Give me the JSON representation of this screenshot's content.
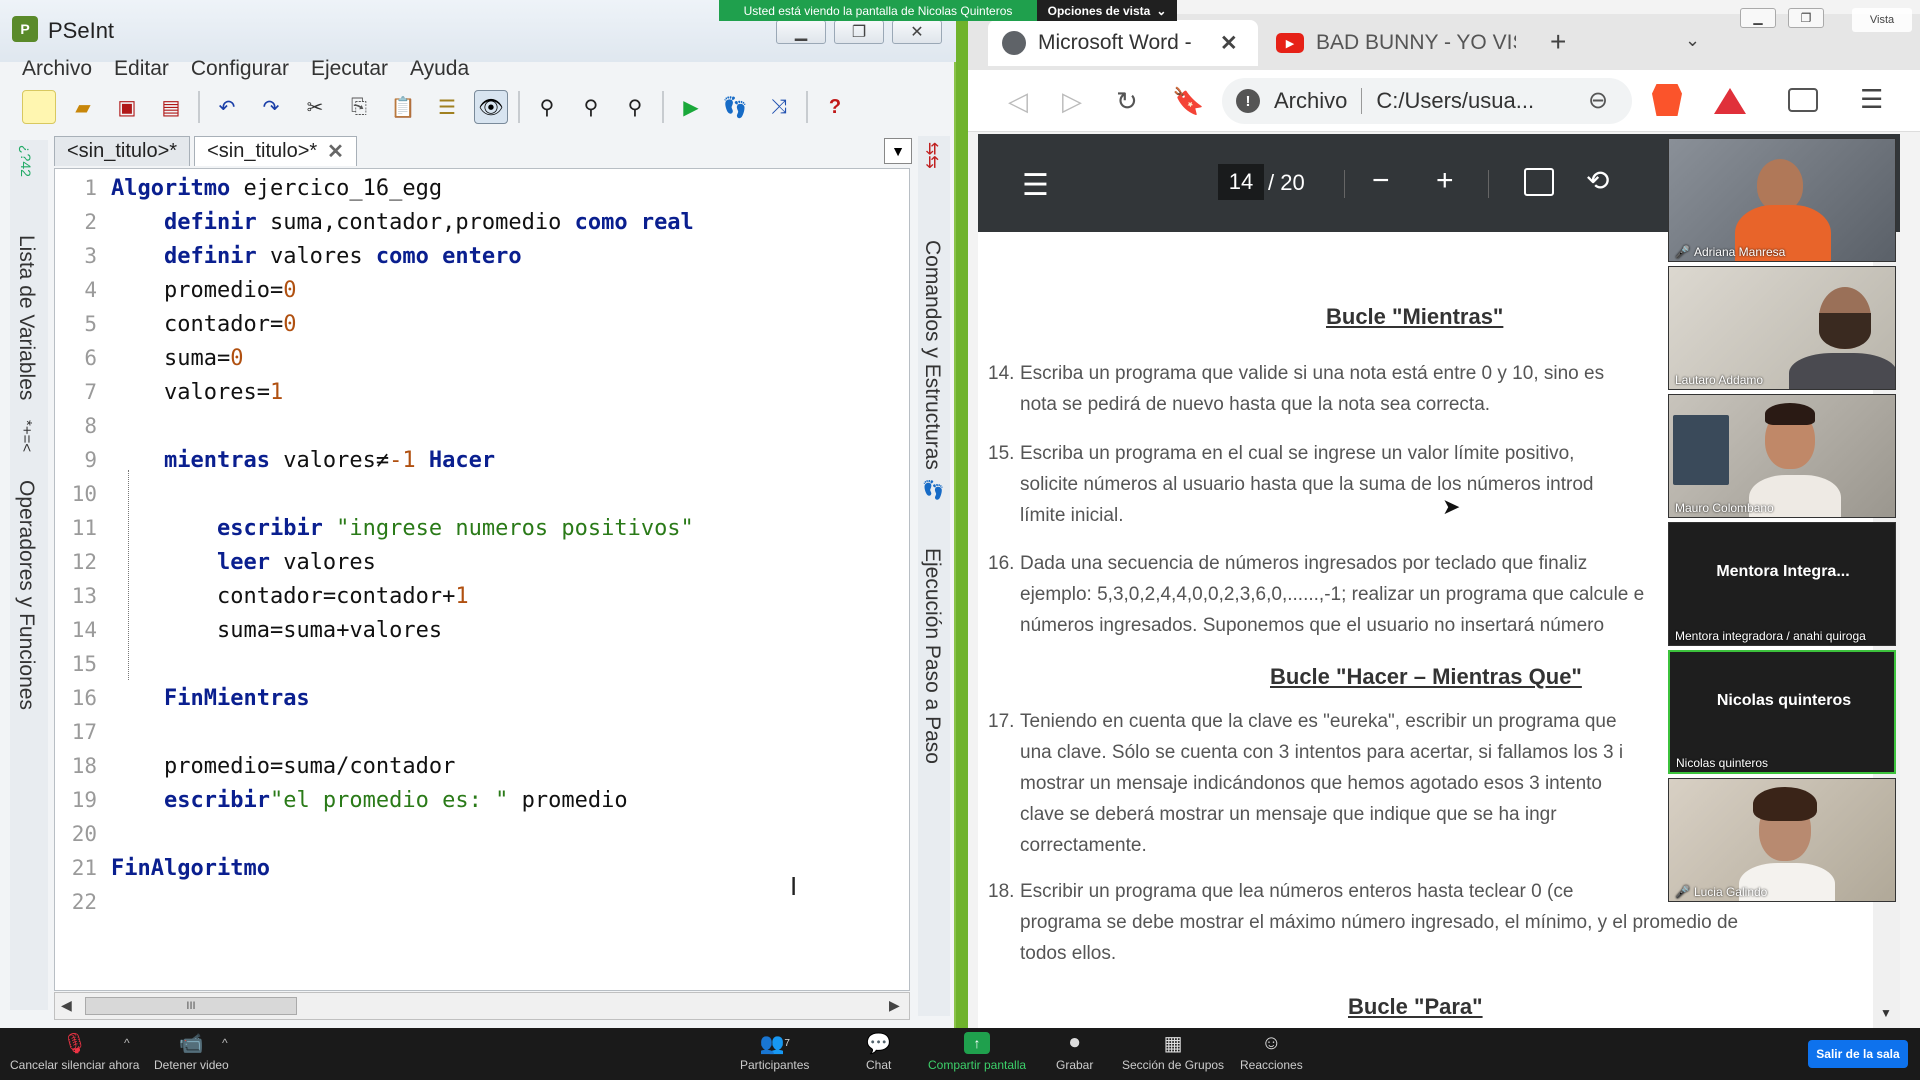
{
  "zoom_share": {
    "banner": "Usted está viendo la pantalla de Nicolas Quinteros",
    "view_options": "Opciones de vista",
    "corner_label": "Vista"
  },
  "pseint": {
    "title": "PSeInt",
    "menu": [
      "Archivo",
      "Editar",
      "Configurar",
      "Ejecutar",
      "Ayuda"
    ],
    "tabs": [
      "<sin_titulo>*",
      "<sin_titulo>*"
    ],
    "left_panel_labels": [
      "Lista de Variables",
      "Operadores y Funciones"
    ],
    "left_panel_symbols": [
      "*+=<",
      "¿?42"
    ],
    "right_panel_labels": [
      "Comandos y Estructuras",
      "Ejecución Paso a Paso"
    ],
    "line_numbers": [
      "1",
      "2",
      "3",
      "4",
      "5",
      "6",
      "7",
      "8",
      "9",
      "10",
      "11",
      "12",
      "13",
      "14",
      "15",
      "16",
      "17",
      "18",
      "19",
      "20",
      "21",
      "22"
    ],
    "code": {
      "l1_kw": "Algoritmo",
      "l1_rest": " ejercico_16_egg",
      "l2_kw": "definir",
      "l2_mid": " suma,contador,promedio ",
      "l2_kw2": "como real",
      "l3_kw": "definir",
      "l3_mid": " valores ",
      "l3_kw2": "como entero",
      "l4_var": "promedio=",
      "l4_num": "0",
      "l5_var": "contador=",
      "l5_num": "0",
      "l6_var": "suma=",
      "l6_num": "0",
      "l7_var": "valores=",
      "l7_num": "1",
      "l9_kw": "mientras",
      "l9_mid": " valores",
      "l9_op": "≠",
      "l9_num": "-1",
      "l9_kw2": " Hacer",
      "l11_kw": "escribir",
      "l11_str": " \"ingrese numeros positivos\"",
      "l12_kw": "leer",
      "l12_rest": " valores",
      "l13_var": "contador=contador",
      "l13_op": "+",
      "l13_num": "1",
      "l14_var": "suma=suma",
      "l14_op": "+",
      "l14_rest": "valores",
      "l16_kw": "FinMientras",
      "l18_var": "promedio=suma/contador",
      "l19_kw": "escribir",
      "l19_str": "\"el promedio es: \"",
      "l19_rest": " promedio",
      "l21_kw": "FinAlgoritmo"
    },
    "scroll_thumb": "III"
  },
  "browser": {
    "tab_active": "Microsoft Word - ",
    "tab_youtube": "BAD BUNNY - YO VIS",
    "address_label": "Archivo",
    "address_url": "C:/Users/usua...",
    "pdf_page": "14",
    "pdf_total": "/ 20"
  },
  "pdf": {
    "h_mientras": "Bucle \"Mientras\"",
    "h_hacer": "Bucle \"Hacer – Mientras Que\"",
    "h_para": "Bucle \"Para\"",
    "items": [
      {
        "n": "14.",
        "lines": [
          "Escriba un programa que valide si una nota está entre 0 y 10, sino es",
          "nota se pedirá de nuevo hasta que la nota sea correcta."
        ]
      },
      {
        "n": "15.",
        "lines": [
          "Escriba un programa en el cual se ingrese un valor límite positivo,",
          "solicite números al usuario hasta que la suma de los números introd",
          "límite inicial."
        ]
      },
      {
        "n": "16.",
        "lines": [
          "Dada una secuencia de números ingresados por teclado que finaliz",
          "ejemplo: 5,3,0,2,4,4,0,0,2,3,6,0,......,-1; realizar un programa que calcule e",
          "números ingresados. Suponemos que el usuario no insertará número"
        ]
      },
      {
        "n": "17.",
        "lines": [
          "Teniendo en cuenta que la clave es \"eureka\", escribir un programa que",
          "una clave. Sólo se cuenta con 3 intentos para acertar, si fallamos los 3 i",
          "mostrar un mensaje indicándonos que hemos agotado esos 3 intento",
          "clave se deberá mostrar un mensaje que indique que se ha ingr",
          "correctamente."
        ]
      },
      {
        "n": "18.",
        "lines": [
          "Escribir un programa que lea números enteros hasta teclear 0 (ce",
          "programa se debe mostrar el máximo número ingresado, el mínimo, y el promedio de",
          "todos ellos."
        ]
      }
    ]
  },
  "participants": [
    {
      "name": "Adriana Manresa",
      "muted": true,
      "video": true
    },
    {
      "name": "Lautaro Addamo",
      "muted": false,
      "video": true
    },
    {
      "name": "Mauro Colombano",
      "muted": false,
      "video": true
    },
    {
      "name": "Mentora integradora / anahi quiroga",
      "display": "Mentora  Integra...",
      "muted": false,
      "video": false
    },
    {
      "name": "Nicolas quinteros",
      "display": "Nicolas quinteros",
      "muted": false,
      "video": false,
      "active": true
    },
    {
      "name": "Lucia Galindo",
      "muted": true,
      "video": true
    }
  ],
  "zoom_bar": {
    "unmute": "Cancelar silenciar ahora",
    "stop_video": "Detener video",
    "participants": "Participantes",
    "participants_count": "7",
    "chat": "Chat",
    "share": "Compartir pantalla",
    "record": "Grabar",
    "breakout": "Sección de Grupos",
    "reactions": "Reacciones",
    "leave": "Salir de la sala"
  }
}
